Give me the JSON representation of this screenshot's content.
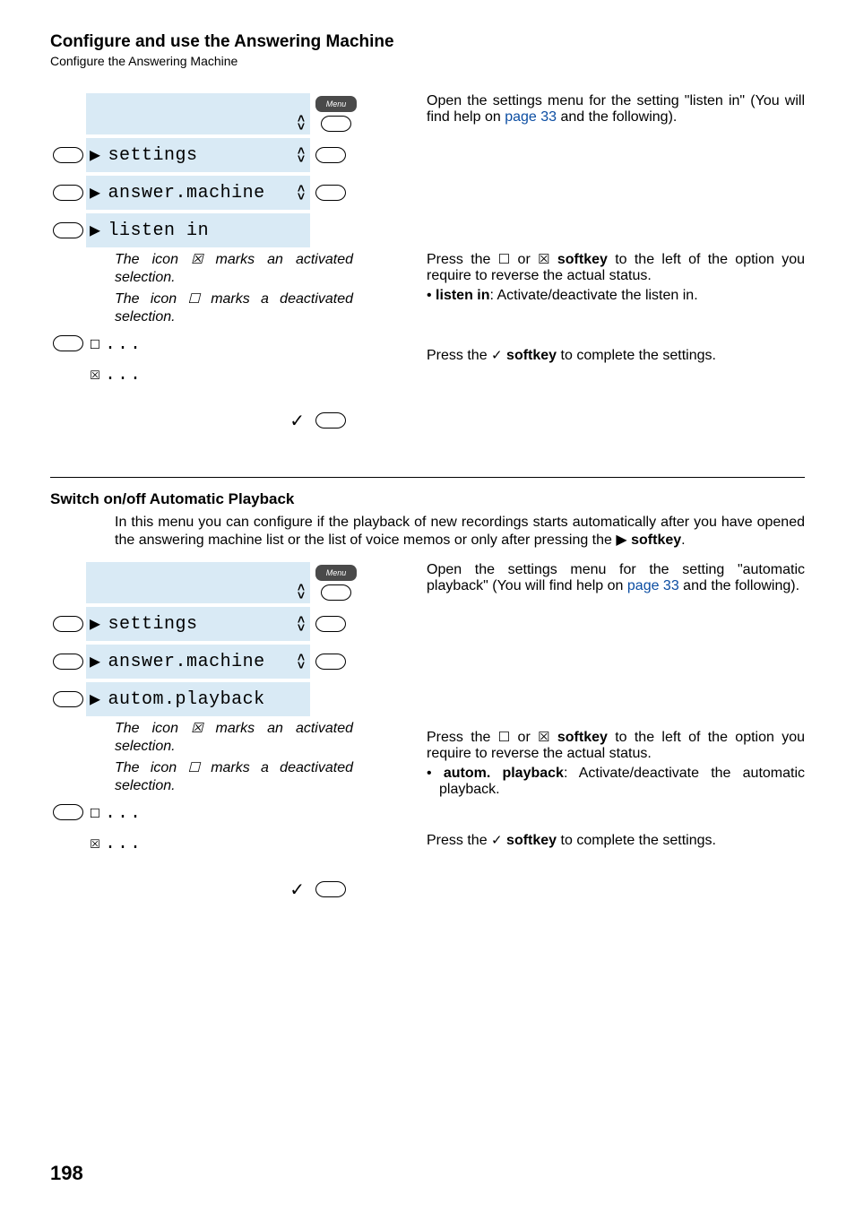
{
  "header": {
    "title": "Configure and use the Answering Machine",
    "subtitle": "Configure the Answering Machine"
  },
  "section1": {
    "r1_para_a": "Open the settings menu for the setting \"listen in\" (You will find help on ",
    "r1_link": "page 33",
    "r1_para_b": " and the following).",
    "menu_label": "Menu",
    "lcd_settings": "settings",
    "lcd_answer": "answer.machine",
    "lcd_listen": "listen in",
    "note_a": "The icon ",
    "note_checked_sym": "☒",
    "note_b": " marks an activated selection.",
    "note_c": "The icon ",
    "note_unchecked_sym": "☐",
    "note_d": " marks a deactivated selection.",
    "opt_unchecked": "☐",
    "opt_checked": "☒",
    "opt_dots": "...",
    "press_a": "Press the ",
    "press_b": " or ",
    "press_c": " softkey",
    "press_d": " to the left of the option you require to reverse the actual status.",
    "bullet_a": "listen in",
    "bullet_b": ": Activate/deactivate the listen in.",
    "confirm_a": "Press the ",
    "confirm_b": " softkey",
    "confirm_c": " to complete the settings.",
    "check_sym": "✓"
  },
  "section2": {
    "heading": "Switch on/off Automatic Playback",
    "intro_a": "In this menu you can configure if the playback of new recordings starts automatically after you have opened the answering machine list or the list of voice memos or only after pressing the ",
    "intro_b": " softkey",
    "intro_c": ".",
    "r1_para_a": "Open the settings menu for the setting \"automatic playback\" (You will find help on ",
    "r1_link": "page 33",
    "r1_para_b": " and the following).",
    "lcd_settings": "settings",
    "lcd_answer": "answer.machine",
    "lcd_autom": "autom.playback",
    "press_a": "Press the ",
    "press_b": " or ",
    "press_c": " softkey",
    "press_d": " to the left of the option you require to reverse the actual status.",
    "bullet_a": "autom. playback",
    "bullet_b": ": Activate/deactivate the automatic playback.",
    "confirm_a": "Press the ",
    "confirm_b": " softkey",
    "confirm_c": " to complete the settings."
  },
  "pagenum": "198"
}
